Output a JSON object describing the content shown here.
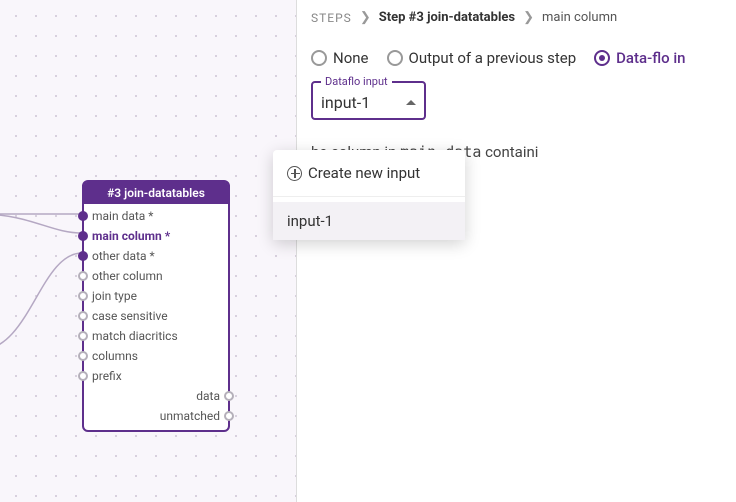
{
  "canvas": {
    "node": {
      "title": "#3 join-datatables",
      "inputs": [
        {
          "label": "main data *",
          "selected": false,
          "connected": true
        },
        {
          "label": "main column *",
          "selected": true,
          "connected": true
        },
        {
          "label": "other data *",
          "selected": false,
          "connected": true
        },
        {
          "label": "other column",
          "selected": false,
          "connected": false
        },
        {
          "label": "join type",
          "selected": false,
          "connected": false
        },
        {
          "label": "case sensitive",
          "selected": false,
          "connected": false
        },
        {
          "label": "match diacritics",
          "selected": false,
          "connected": false
        },
        {
          "label": "columns",
          "selected": false,
          "connected": false
        },
        {
          "label": "prefix",
          "selected": false,
          "connected": false
        }
      ],
      "outputs": [
        {
          "label": "data"
        },
        {
          "label": "unmatched"
        }
      ]
    }
  },
  "panel": {
    "breadcrumb": {
      "root": "STEPS",
      "step": "Step #3 join-datatables",
      "field": "main column"
    },
    "radios": {
      "none": "None",
      "prev": "Output of a previous step",
      "dataflo": "Data-flo in"
    },
    "select": {
      "legend": "Dataflo input",
      "value": "input-1"
    },
    "desc_prefix": "he column in ",
    "desc_mono": "main data",
    "desc_suffix": " containi",
    "dropdown": {
      "create": "Create new input",
      "items": [
        "input-1"
      ]
    }
  }
}
